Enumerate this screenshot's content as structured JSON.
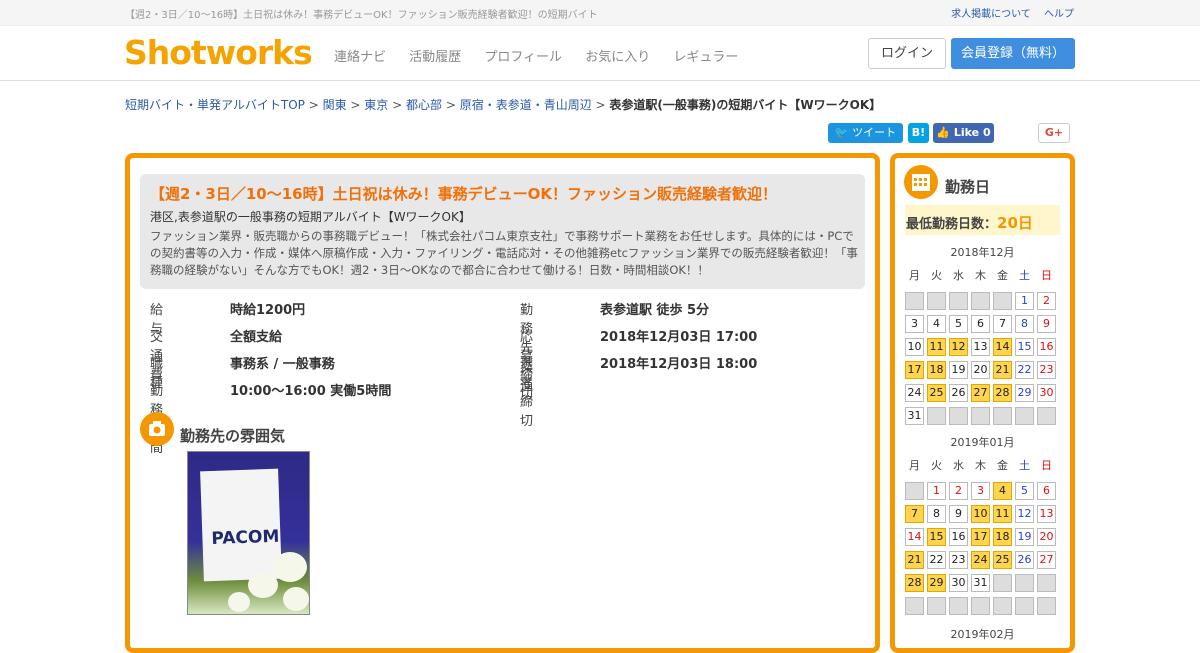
{
  "topbar": {
    "tagline": "【週2・3日／10～16時】土日祝は休み！事務デビューOK！ファッション販売経験者歓迎！の短期バイト",
    "links": [
      "求人掲載について",
      "ヘルプ"
    ]
  },
  "header": {
    "logo": "Shotworks",
    "nav": [
      "連絡ナビ",
      "活動履歴",
      "プロフィール",
      "お気に入り",
      "レギュラー"
    ],
    "login": "ログイン",
    "register": "会員登録（無料）"
  },
  "breadcrumb": {
    "items": [
      "短期バイト・単発アルバイトTOP",
      "関東",
      "東京",
      "都心部",
      "原宿・表参道・青山周辺"
    ],
    "current": "表参道駅(一般事務)の短期バイト【WワークOK】"
  },
  "social": {
    "tweet": "ツイート",
    "hatena": "B!",
    "fb_like": "Like",
    "fb_count": "0",
    "gplus": "G+"
  },
  "job": {
    "title": "【週2・3日／10～16時】土日祝は休み！事務デビューOK！ファッション販売経験者歓迎！",
    "subtitle": "港区,表参道駅の一般事務の短期アルバイト【WワークOK】",
    "description": "ファッション業界・販売職からの事務職デビュー！「株式会社パコム東京支社」で事務サポート業務をお任せします。具体的には・PCでの契約書等の入力・作成・媒体へ原稿作成・入力・ファイリング・電話応対・その他雑務etcファッション業界での販売経験者歓迎！「事務職の経験がない」そんな方でもOK！週2・3日～OKなので都合に合わせて働ける！日数・時間相談OK！！",
    "left": [
      {
        "k": "給与",
        "v": "時給1200円"
      },
      {
        "k": "交通費",
        "v": "全額支給"
      },
      {
        "k": "職種",
        "v": "事務系 / 一般事務"
      },
      {
        "k": "勤務時間",
        "v": "10:00～16:00 実働5時間"
      }
    ],
    "right": [
      {
        "k": "勤務先交通",
        "v": "表参道駅 徒歩 5分"
      },
      {
        "k": "応募締切",
        "v": "2018年12月03日 17:00"
      },
      {
        "k": "選考締切",
        "v": "2018年12月03日 18:00"
      }
    ],
    "atmosphere": "勤務先の雰囲気",
    "photo_text": "PACOM"
  },
  "sidebar": {
    "title": "勤務日",
    "min_label": "最低勤務日数：",
    "min_value": "20日",
    "weekdays": [
      "月",
      "火",
      "水",
      "木",
      "金",
      "土",
      "日"
    ],
    "months": [
      {
        "label": "2018年12月",
        "rows": [
          [
            null,
            null,
            null,
            null,
            null,
            1,
            2
          ],
          [
            3,
            4,
            5,
            6,
            7,
            8,
            9
          ],
          [
            10,
            11,
            12,
            13,
            14,
            15,
            16
          ],
          [
            17,
            18,
            19,
            20,
            21,
            22,
            23
          ],
          [
            24,
            25,
            26,
            27,
            28,
            29,
            30
          ],
          [
            31,
            null,
            null,
            null,
            null,
            null,
            null
          ]
        ],
        "highlight": [
          11,
          12,
          14,
          17,
          18,
          21,
          25,
          27,
          28
        ]
      },
      {
        "label": "2019年01月",
        "rows": [
          [
            null,
            1,
            2,
            3,
            4,
            5,
            6
          ],
          [
            7,
            8,
            9,
            10,
            11,
            12,
            13
          ],
          [
            14,
            15,
            16,
            17,
            18,
            19,
            20
          ],
          [
            21,
            22,
            23,
            24,
            25,
            26,
            27
          ],
          [
            28,
            29,
            30,
            31,
            null,
            null,
            null
          ],
          [
            null,
            null,
            null,
            null,
            null,
            null,
            null
          ]
        ],
        "highlight": [
          4,
          7,
          10,
          11,
          15,
          17,
          18,
          21,
          24,
          25,
          28,
          29
        ],
        "holidays": [
          1,
          2,
          3,
          14
        ]
      }
    ],
    "next_month": "2019年02月"
  }
}
